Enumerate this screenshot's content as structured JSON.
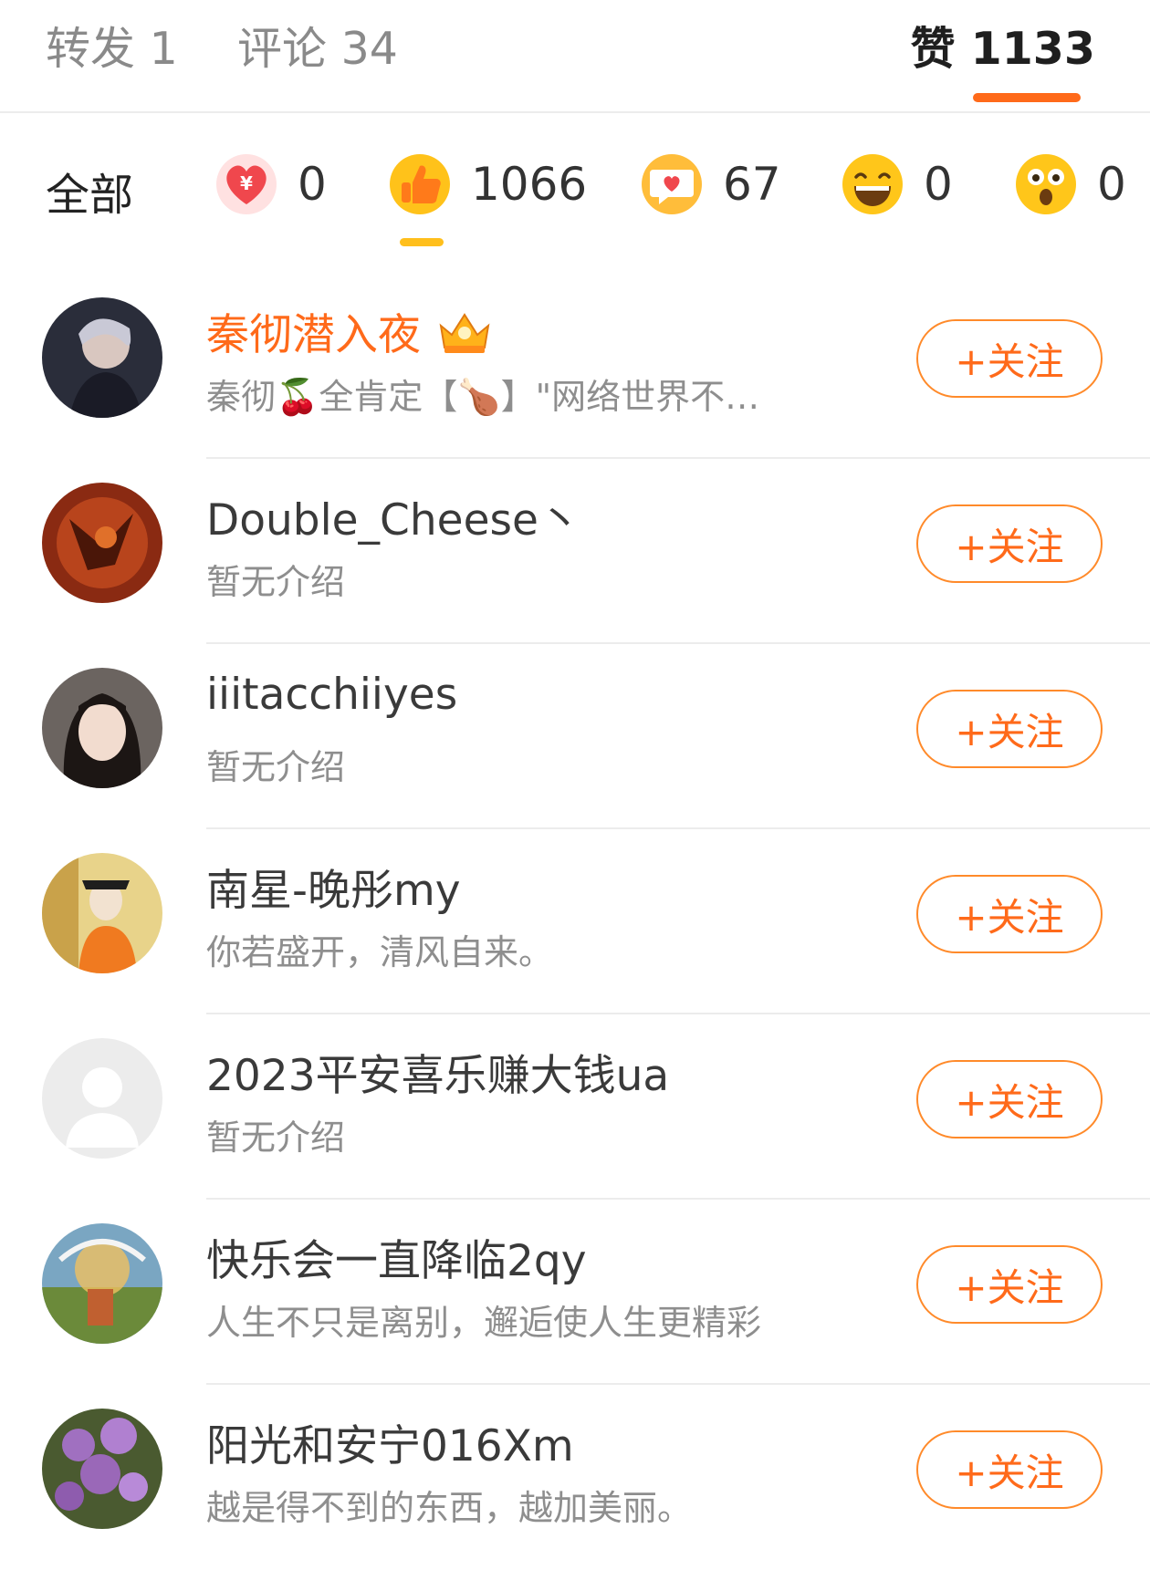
{
  "tabs": {
    "repost": "转发 1",
    "comment": "评论 34",
    "like": "赞 1133"
  },
  "filters": {
    "all": "全部",
    "reactions": [
      {
        "icon": "money-heart-icon",
        "count": "0"
      },
      {
        "icon": "thumbs-up-icon",
        "count": "1066"
      },
      {
        "icon": "heart-bubble-icon",
        "count": "67"
      },
      {
        "icon": "laughing-face-icon",
        "count": "0"
      },
      {
        "icon": "surprised-face-icon",
        "count": "0"
      }
    ]
  },
  "colors": {
    "accent": "#ff6a1a",
    "filter_indicator": "#ffbf1c"
  },
  "users": [
    {
      "name": "秦彻潜入夜",
      "vip": true,
      "bio": "秦彻🍒全肯定【🍗】\"网络世界不…",
      "follow": "+关注"
    },
    {
      "name": "Double_Cheese丶",
      "vip": false,
      "bio": "暂无介绍",
      "follow": "+关注"
    },
    {
      "name": "iiitacchiiyes",
      "vip": false,
      "bio": "暂无介绍",
      "follow": "+关注"
    },
    {
      "name": "南星-晚彤my",
      "vip": false,
      "bio": "你若盛开，清风自来。",
      "follow": "+关注"
    },
    {
      "name": "2023平安喜乐赚大钱ua",
      "vip": false,
      "bio": "暂无介绍",
      "follow": "+关注"
    },
    {
      "name": "快乐会一直降临2qy",
      "vip": false,
      "bio": "人生不只是离别，邂逅使人生更精彩",
      "follow": "+关注"
    },
    {
      "name": "阳光和安宁016Xm",
      "vip": false,
      "bio": "越是得不到的东西，越加美丽。",
      "follow": "+关注"
    }
  ]
}
